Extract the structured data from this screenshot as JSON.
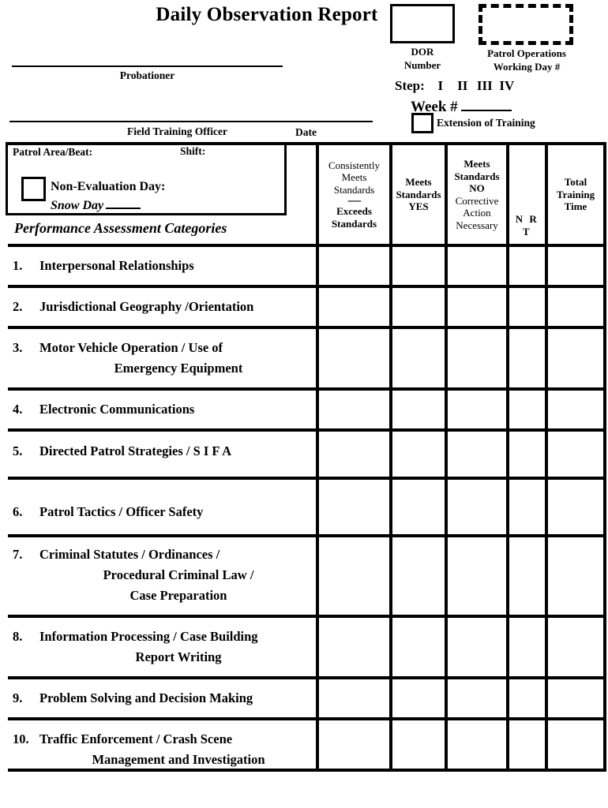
{
  "header": {
    "title": "Daily Observation Report",
    "dor_box_caption": "DOR\nNumber",
    "dor_caption_line1": "DOR",
    "dor_caption_line2": "Number",
    "patrol_ops_caption_line1": "Patrol Operations",
    "patrol_ops_caption_line2": "Working Day #",
    "step_label": "Step:",
    "step_options": [
      "I",
      "II",
      "III",
      "IV"
    ],
    "week_label": "Week #",
    "week_value": "",
    "extension_label": "Extension of Training",
    "extension_checked": false
  },
  "signatures": {
    "probationer_label": "Probationer",
    "probationer_value": "",
    "fto_label": "Field Training Officer",
    "fto_value": "",
    "date_label": "Date",
    "date_value": ""
  },
  "patrol_box": {
    "beat_label": "Patrol Area/Beat:",
    "beat_value": "",
    "shift_label": "Shift:",
    "shift_value": "",
    "non_eval_label": "Non-Evaluation Day:",
    "non_eval_checked": false,
    "snow_day_label": "Snow Day",
    "snow_day_value": ""
  },
  "section_title": "Performance Assessment Categories",
  "table": {
    "columns": [
      {
        "id": "consistently-meets-standards",
        "lines_regular": [
          "Consistently",
          "Meets",
          "Standards"
        ],
        "separator": "-----",
        "lines_bold": [
          "Exceeds",
          "Standards"
        ]
      },
      {
        "id": "meets-standards-yes",
        "lines_bold": [
          "Meets",
          "Standards",
          "YES"
        ]
      },
      {
        "id": "meets-standards-no-corrective-action",
        "lines_bold": [
          "Meets",
          "Standards",
          "NO"
        ],
        "lines_regular": [
          "Corrective",
          "Action",
          "Necessary"
        ]
      },
      {
        "id": "nrt",
        "lines_bold": [
          "N R T"
        ]
      },
      {
        "id": "total-training-time",
        "lines_bold": [
          "Total",
          "Training",
          "Time"
        ]
      }
    ],
    "rows": [
      {
        "number": "1.",
        "lines": [
          "Interpersonal Relationships"
        ]
      },
      {
        "number": "2.",
        "lines": [
          "Jurisdictional Geography /Orientation"
        ]
      },
      {
        "number": "3.",
        "lines": [
          "Motor Vehicle Operation / Use of",
          "Emergency Equipment"
        ]
      },
      {
        "number": "4.",
        "lines": [
          "Electronic Communications"
        ]
      },
      {
        "number": "5.",
        "lines": [
          "Directed Patrol Strategies / S I F A"
        ]
      },
      {
        "number": "6.",
        "lines": [
          "Patrol Tactics / Officer Safety"
        ]
      },
      {
        "number": "7.",
        "lines": [
          "Criminal Statutes / Ordinances /",
          "Procedural Criminal Law /",
          "Case Preparation"
        ]
      },
      {
        "number": "8.",
        "lines": [
          "Information Processing / Case Building",
          "Report Writing"
        ]
      },
      {
        "number": "9.",
        "lines": [
          "Problem Solving and Decision Making"
        ]
      },
      {
        "number": "10.",
        "lines": [
          "Traffic Enforcement / Crash Scene",
          "Management and Investigation"
        ]
      }
    ]
  }
}
